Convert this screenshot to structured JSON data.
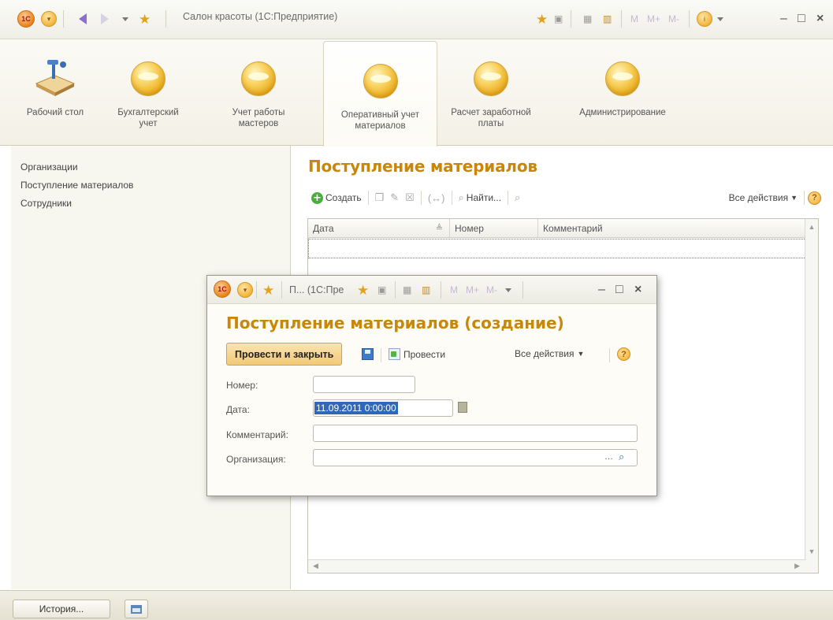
{
  "app": {
    "title": "Салон красоты (1С:Предприятие)",
    "logo": "1С",
    "memory_buttons": [
      "M",
      "M+",
      "M-"
    ]
  },
  "sections": [
    {
      "label": "Рабочий стол",
      "icon": "desk-lamp-icon"
    },
    {
      "label": "Бухгалтерский учет",
      "icon": "section-orb-icon"
    },
    {
      "label": "Учет работы мастеров",
      "icon": "section-orb-icon"
    },
    {
      "label": "Оперативный учет материалов",
      "icon": "section-orb-icon",
      "active": true
    },
    {
      "label": "Расчет заработной платы",
      "icon": "section-orb-icon"
    },
    {
      "label": "Администрирование",
      "icon": "section-orb-icon"
    }
  ],
  "nav": {
    "items": [
      "Организации",
      "Поступление материалов",
      "Сотрудники"
    ]
  },
  "list": {
    "title": "Поступление материалов",
    "toolbar": {
      "create_label": "Создать",
      "find_label": "Найти...",
      "all_actions_label": "Все действия"
    },
    "columns": [
      "Дата",
      "Номер",
      "Комментарий"
    ]
  },
  "dialog": {
    "titlebar_text": "П... (1С:Пре",
    "title": "Поступление материалов (создание)",
    "post_close_label": "Провести и закрыть",
    "post_label": "Провести",
    "all_actions_label": "Все действия",
    "fields": {
      "number_label": "Номер:",
      "number_value": "",
      "date_label": "Дата:",
      "date_value": "11.09.2011  0:00:00",
      "comment_label": "Комментарий:",
      "comment_value": "",
      "org_label": "Организация:",
      "org_value": ""
    }
  },
  "bottom": {
    "history_label": "История..."
  },
  "colors": {
    "accent_title": "#c88708",
    "selection": "#3267b6",
    "create_plus": "#4aae3c"
  }
}
